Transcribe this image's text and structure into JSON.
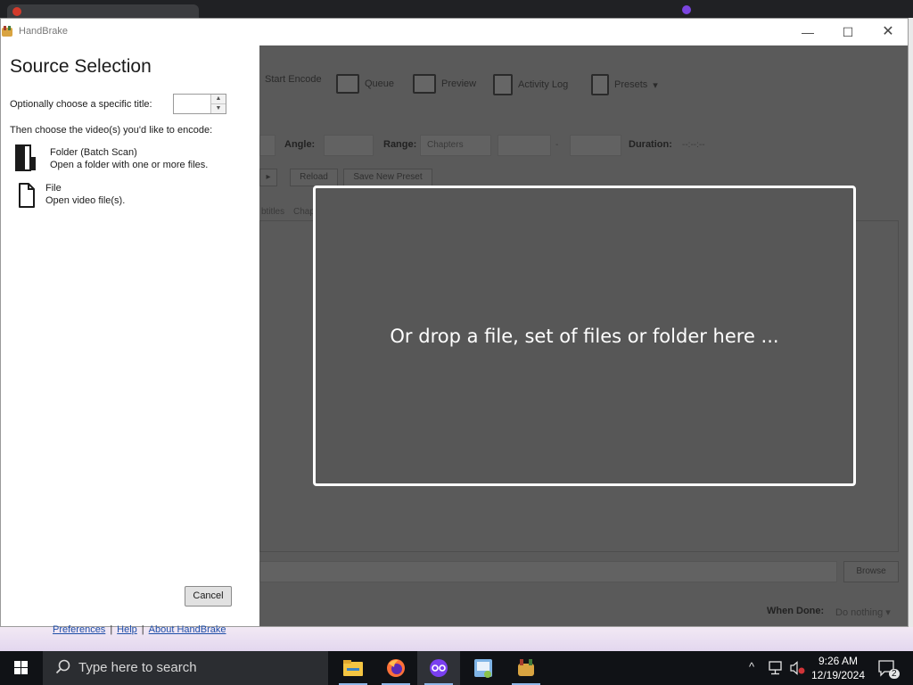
{
  "window": {
    "title": "HandBrake",
    "minimize_glyph": "—",
    "maximize_glyph": "☐",
    "close_glyph": "✕"
  },
  "toolbar": {
    "start_encode": "Start Encode",
    "queue": "Queue",
    "preview": "Preview",
    "activity_log": "Activity Log",
    "presets": "Presets"
  },
  "source_bar": {
    "angle_label": "Angle:",
    "range_label": "Range:",
    "range_value": "Chapters",
    "range_sep": "-",
    "duration_label": "Duration:",
    "duration_value": "--:--:--"
  },
  "preset_bar": {
    "reload": "Reload",
    "save_new_preset": "Save New Preset"
  },
  "tabs": [
    "btitles",
    "Chapters"
  ],
  "drop_zone": {
    "text": "Or drop a file, set of files or folder here ..."
  },
  "footer": {
    "browse": "Browse",
    "when_done_label": "When Done:",
    "when_done_value": "Do nothing ▾"
  },
  "source_panel": {
    "heading": "Source Selection",
    "title_prompt": "Optionally choose a specific title:",
    "title_value": "",
    "choose_prompt": "Then choose the video(s) you'd like to encode:",
    "options": [
      {
        "title": "Folder (Batch Scan)",
        "description": "Open a folder with one or more files."
      },
      {
        "title": "File",
        "description": "Open video file(s)."
      }
    ],
    "cancel": "Cancel",
    "links": [
      "Preferences",
      "Help",
      "About HandBrake"
    ],
    "link_separator": "|"
  },
  "taskbar": {
    "search_placeholder": "Type here to search",
    "time": "9:26 AM",
    "date": "12/19/2024",
    "notification_count": "2",
    "apps": [
      "File Explorer",
      "Firefox",
      "Stylus",
      "Quick Assist",
      "HandBrake"
    ]
  }
}
